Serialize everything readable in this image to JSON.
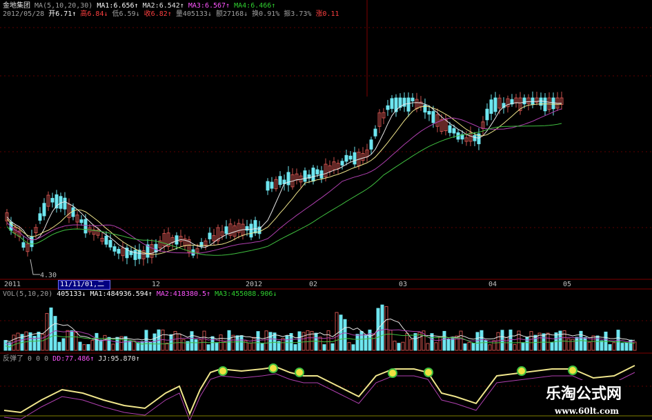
{
  "header": {
    "stock_name": "金地集团",
    "ma_label": "MA(5,10,20,30)",
    "ma1": "MA1:6.656↑",
    "ma2": "MA2:6.542↑",
    "ma3": "MA3:6.567↑",
    "ma4": "MA4:6.466↑",
    "date": "2012/05/28",
    "open": "开6.71↑",
    "high": "高6.84↓",
    "low": "低6.59↓",
    "close": "收6.82↑",
    "volume": "量405133↓",
    "amount": "额27168↓",
    "turnover": "换0.91%",
    "amplitude": "振3.73%",
    "change": "涨0.11"
  },
  "price_chart": {
    "low_marker": "4.30",
    "colors": {
      "up": "#c8504c",
      "down": "#6ee6f0",
      "ma_white": "#e8e8e8",
      "ma_yellow": "#f0e68c",
      "ma_purple": "#b040b0",
      "ma_green": "#40c040"
    }
  },
  "time_axis": {
    "labels": [
      "2011",
      "11/11/01,二",
      "12",
      "2012",
      "02",
      "03",
      "04",
      "05"
    ]
  },
  "volume_panel": {
    "label": "VOL(5,10,20)",
    "value": "405133↓",
    "ma1": "MA1:484936.594↑",
    "ma2": "MA2:418380.5↑",
    "ma3": "MA3:455088.906↓"
  },
  "indicator_panel": {
    "name": "反弹了",
    "zeros": "0 0 0",
    "dd": "DD:77.486↑",
    "jj": "JJ:95.870↑"
  },
  "watermark": {
    "title": "乐淘公式网",
    "url": "www.60lt.com"
  }
}
